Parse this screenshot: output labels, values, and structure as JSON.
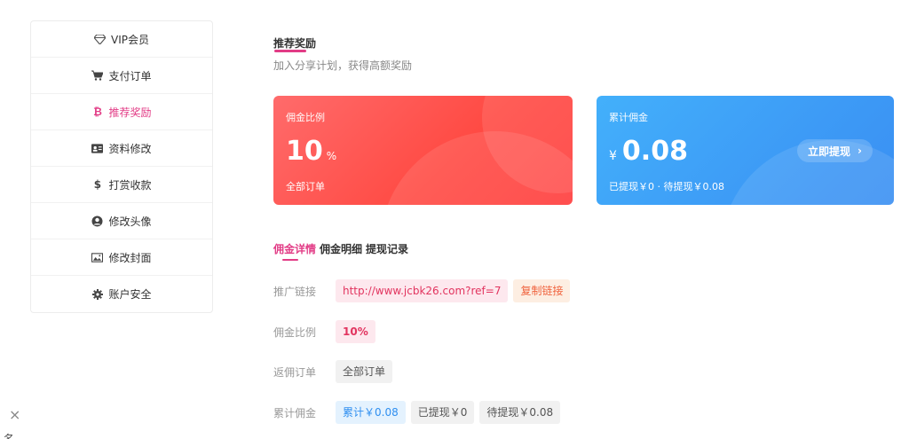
{
  "sidebar": {
    "items": [
      {
        "label": "VIP会员",
        "icon": "diamond-icon",
        "active": false
      },
      {
        "label": "支付订单",
        "icon": "cart-icon",
        "active": false
      },
      {
        "label": "推荐奖励",
        "icon": "bitcoin-icon",
        "active": true
      },
      {
        "label": "资料修改",
        "icon": "id-card-icon",
        "active": false
      },
      {
        "label": "打赏收款",
        "icon": "dollar-icon",
        "active": false
      },
      {
        "label": "修改头像",
        "icon": "user-circle-icon",
        "active": false
      },
      {
        "label": "修改封面",
        "icon": "image-icon",
        "active": false
      },
      {
        "label": "账户安全",
        "icon": "gear-icon",
        "active": false
      }
    ]
  },
  "header": {
    "title": "推荐奖励",
    "subtitle": "加入分享计划，获得高额奖励"
  },
  "cards": {
    "rate": {
      "label": "佣金比例",
      "value": "10",
      "unit": "%",
      "footer": "全部订单"
    },
    "total": {
      "label": "累计佣金",
      "currency": "¥",
      "value": "0.08",
      "footer": "已提现￥0 · 待提现￥0.08",
      "button": "立即提现"
    }
  },
  "tabs": [
    {
      "label": "佣金详情",
      "active": true
    },
    {
      "label": "佣金明细",
      "active": false
    },
    {
      "label": "提现记录",
      "active": false
    }
  ],
  "details": {
    "link_label": "推广链接",
    "link_value": "http://www.jcbk26.com?ref=7",
    "copy_label": "复制链接",
    "rate_label": "佣金比例",
    "rate_value": "10%",
    "orders_label": "返佣订单",
    "orders_value": "全部订单",
    "commission_label": "累计佣金",
    "commission_total": "累计￥0.08",
    "commission_withdrawn": "已提现￥0",
    "commission_pending": "待提现￥0.08"
  },
  "misc": {
    "close_glyph": "×",
    "bottom_char": "名"
  },
  "colors": {
    "accent": "#e23c86",
    "red_card": "#ff4a43",
    "blue_card": "#3d9bf6"
  }
}
